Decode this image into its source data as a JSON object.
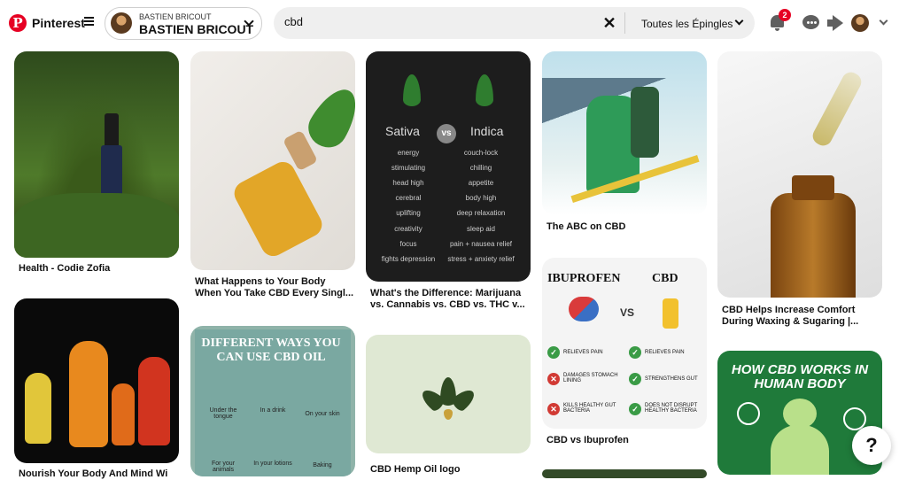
{
  "header": {
    "brand": "Pinterest",
    "account": {
      "small_name": "BASTIEN BRICOUT",
      "name": "BASTIEN BRICOUT"
    },
    "search": {
      "value": "cbd",
      "scope": "Toutes les Épingles"
    },
    "notifications_count": "2"
  },
  "pins": [
    {
      "caption": "Health - Codie Zofia"
    },
    {
      "caption": "What Happens to Your Body When You Take CBD Every Singl..."
    },
    {
      "caption": "What's the Difference: Marijuana vs. Cannabis vs. CBD vs. THC v..."
    },
    {
      "caption": "The ABC on CBD"
    },
    {
      "caption": "CBD Helps Increase Comfort During Waxing & Sugaring |..."
    },
    {
      "caption": "Nourish Your Body And Mind Wi"
    },
    {
      "caption": ""
    },
    {
      "caption": "CBD Hemp Oil logo"
    },
    {
      "caption": "CBD vs Ibuprofen"
    },
    {
      "caption": ""
    }
  ],
  "sativa_indica": {
    "left_title": "Sativa",
    "right_title": "Indica",
    "vs": "vs",
    "left_items": [
      "energy",
      "stimulating",
      "head high",
      "cerebral",
      "uplifting",
      "creativity",
      "focus",
      "fights depression"
    ],
    "right_items": [
      "couch-lock",
      "chilling",
      "appetite",
      "body high",
      "deep relaxation",
      "sleep aid",
      "pain + nausea relief",
      "stress + anxiety relief"
    ]
  },
  "ways_infographic": {
    "title": "DIFFERENT WAYS YOU CAN USE CBD OIL",
    "labels": [
      "Under the tongue",
      "In a drink",
      "On your skin",
      "For your animals",
      "In your lotions",
      "Baking"
    ]
  },
  "ibuprofen_infographic": {
    "left_title": "IBUPROFEN",
    "right_title": "CBD",
    "vs": "VS",
    "left_items": [
      "RELIEVES PAIN",
      "DAMAGES STOMACH LINING",
      "KILLS HEALTHY GUT BACTERIA"
    ],
    "right_items": [
      "RELIEVES PAIN",
      "STRENGTHENS GUT",
      "DOES NOT DISRUPT HEALTHY BACTERIA"
    ]
  },
  "how_cbd_works": {
    "title": "HOW CBD WORKS IN HUMAN BODY"
  },
  "help": {
    "label": "?"
  }
}
